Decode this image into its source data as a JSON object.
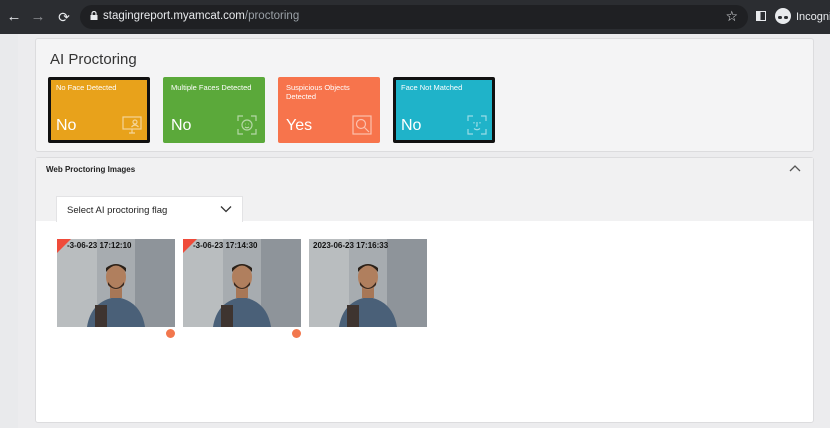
{
  "browser": {
    "url_domain": "stagingreport.myamcat.com",
    "url_path": "/proctoring",
    "profile_label": "Incognito"
  },
  "ai_proctoring": {
    "title": "AI Proctoring",
    "flags": [
      {
        "label": "No Face Detected",
        "value": "No",
        "color": "#e8a21b",
        "icon": "monitor-person-icon",
        "selected": true
      },
      {
        "label": "Multiple Faces Detected",
        "value": "No",
        "color": "#5ba93a",
        "icon": "face-scan-icon",
        "selected": false
      },
      {
        "label": "Suspicious Objects Detected",
        "value": "Yes",
        "color": "#f7744c",
        "icon": "object-search-icon",
        "selected": false
      },
      {
        "label": "Face Not Matched",
        "value": "No",
        "color": "#1fb3c9",
        "icon": "face-id-icon",
        "selected": true
      }
    ]
  },
  "web_proctoring": {
    "title": "Web Proctoring Images",
    "select_value": "Select AI proctoring flag",
    "images": [
      {
        "timestamp": "-3-06-23 17:12:10",
        "flagged": true
      },
      {
        "timestamp": "-3-06-23 17:14:30",
        "flagged": true
      },
      {
        "timestamp": "2023-06-23 17:16:33",
        "flagged": false
      }
    ]
  }
}
